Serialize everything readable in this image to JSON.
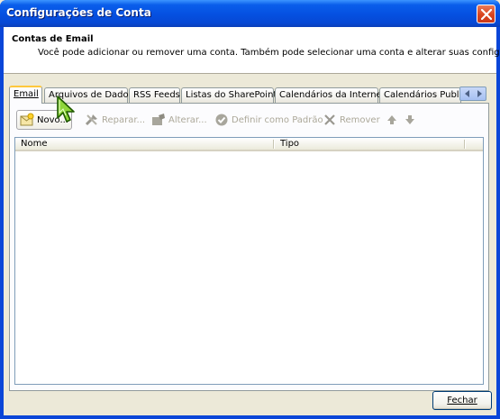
{
  "window": {
    "title": "Configurações de Conta"
  },
  "header": {
    "title": "Contas de Email",
    "description": "Você pode adicionar ou remover uma conta. Também pode selecionar uma conta e alterar suas configurações."
  },
  "tabs": [
    {
      "label": "Email",
      "active": true
    },
    {
      "label": "Arquivos de Dados",
      "active": false
    },
    {
      "label": "RSS Feeds",
      "active": false
    },
    {
      "label": "Listas do SharePoint",
      "active": false
    },
    {
      "label": "Calendários da Internet",
      "active": false
    },
    {
      "label": "Calendários Publica",
      "active": false
    }
  ],
  "toolbar": {
    "novo": {
      "label": "Novo...",
      "icon": "new-account-icon",
      "enabled": true
    },
    "reparar": {
      "label": "Reparar...",
      "icon": "repair-icon",
      "enabled": false
    },
    "alterar": {
      "label": "Alterar...",
      "icon": "change-icon",
      "enabled": false
    },
    "definir_padrao": {
      "label": "Definir como Padrão",
      "icon": "check-circle-icon",
      "enabled": false
    },
    "remover": {
      "label": "Remover",
      "icon": "remove-x-icon",
      "enabled": false
    },
    "move_up": {
      "icon": "arrow-up-icon",
      "enabled": false
    },
    "move_down": {
      "icon": "arrow-down-icon",
      "enabled": false
    }
  },
  "list": {
    "columns": [
      "Nome",
      "Tipo"
    ],
    "rows": []
  },
  "footer": {
    "close_label": "Fechar"
  },
  "colors": {
    "titlebar": "#0550E0",
    "face": "#ECE9D8",
    "active_tab_accent": "#FFC83C",
    "disabled_text": "#ACA899"
  }
}
